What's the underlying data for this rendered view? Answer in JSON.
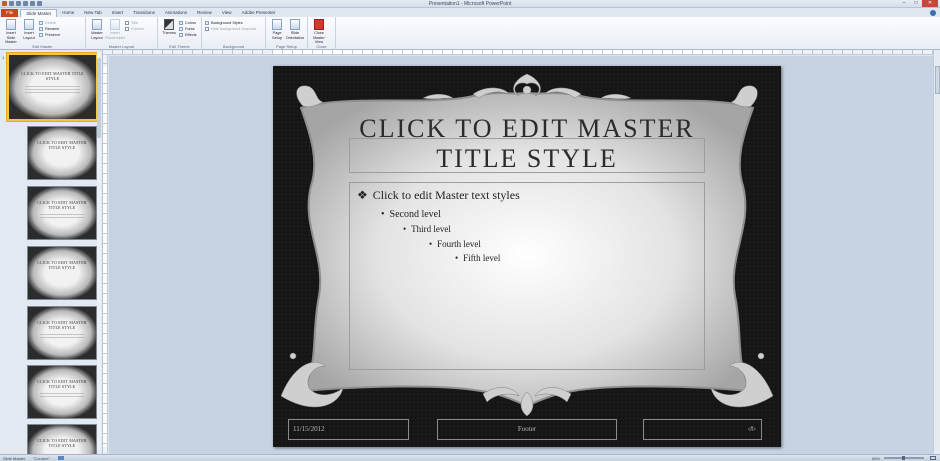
{
  "window": {
    "title": "Presentation1 - Microsoft PowerPoint",
    "controls": [
      "–",
      "□",
      "✕"
    ]
  },
  "ribbon_tabs": [
    "File",
    "Slide Master",
    "Home",
    "New Tab",
    "Insert",
    "Transitions",
    "Animations",
    "Review",
    "View",
    "Adobe Presenter"
  ],
  "ribbon": {
    "edit_master": {
      "label": "Edit Master",
      "insert_slide_master": "Insert Slide Master",
      "insert_layout": "Insert Layout",
      "delete": "Delete",
      "rename": "Rename",
      "preserve": "Preserve"
    },
    "master_layout": {
      "label": "Master Layout",
      "master_layout": "Master Layout",
      "insert_placeholder": "Insert Placeholder",
      "title": "Title",
      "footers": "Footers"
    },
    "edit_theme": {
      "label": "Edit Theme",
      "themes": "Themes",
      "colors": "Colors",
      "fonts": "Fonts",
      "effects": "Effects"
    },
    "background": {
      "label": "Background",
      "background_styles": "Background Styles",
      "hide_background_graphics": "Hide Background Graphics"
    },
    "page_setup": {
      "label": "Page Setup",
      "page_setup": "Page Setup",
      "slide_orientation": "Slide Orientation"
    },
    "close": {
      "label": "Close",
      "close_master_view": "Close Master View"
    }
  },
  "thumbnails": {
    "master_number": "1",
    "items": [
      {
        "title": "CLICK TO EDIT MASTER TITLE STYLE"
      },
      {
        "title": "CLICK TO EDIT MASTER TITLE STYLE"
      },
      {
        "title": "CLICK TO EDIT MASTER TITLE STYLE"
      },
      {
        "title": "CLICK TO EDIT MASTER TITLE STYLE"
      },
      {
        "title": "CLICK TO EDIT MASTER TITLE STYLE"
      },
      {
        "title": "CLICK TO EDIT MASTER TITLE STYLE"
      }
    ]
  },
  "slide": {
    "title": "Click to edit Master title style",
    "levels": {
      "first": "Click to edit Master text styles",
      "second": "Second level",
      "third": "Third level",
      "fourth": "Fourth level",
      "fifth": "Fifth level"
    },
    "bullets": {
      "first": "❖",
      "other": "•"
    },
    "footer": {
      "date": "11/15/2012",
      "text": "Footer",
      "number": "‹#›"
    }
  },
  "statusbar": {
    "view": "Slide Master",
    "theme": "\"Couture\"",
    "zoom": "68%"
  }
}
